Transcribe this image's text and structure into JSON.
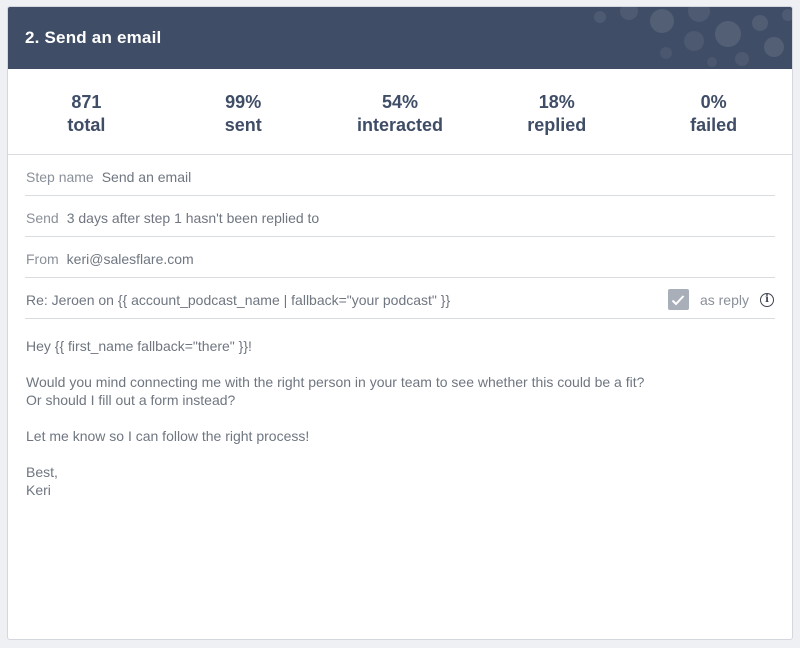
{
  "header": {
    "title": "2. Send an email",
    "color": "#3f4d66"
  },
  "stats": [
    {
      "value": "871",
      "label": "total"
    },
    {
      "value": "99%",
      "label": "sent"
    },
    {
      "value": "54%",
      "label": "interacted"
    },
    {
      "value": "18%",
      "label": "replied"
    },
    {
      "value": "0%",
      "label": "failed"
    }
  ],
  "form": {
    "step_name_label": "Step name",
    "step_name_value": "Send an email",
    "send_label": "Send",
    "send_value": "3 days after step 1 hasn't been replied to",
    "from_label": "From",
    "from_value": "keri@salesflare.com",
    "subject_value": "Re: Jeroen on {{ account_podcast_name | fallback=\"your podcast\" }}",
    "as_reply_label": "as reply",
    "as_reply_checked": true
  },
  "body": {
    "line1": "Hey {{ first_name fallback=\"there\" }}!",
    "line2": "Would you mind connecting me with the right person in your team to see whether this could be a fit?",
    "line3": "Or should I fill out a form instead?",
    "line4": "Let me know so I can follow the right process!",
    "line5": "Best,",
    "line6": "Keri"
  },
  "icons": {
    "checkbox": "checkmark-icon",
    "info": "info-icon",
    "header_decoration": "bubbles-decoration"
  }
}
